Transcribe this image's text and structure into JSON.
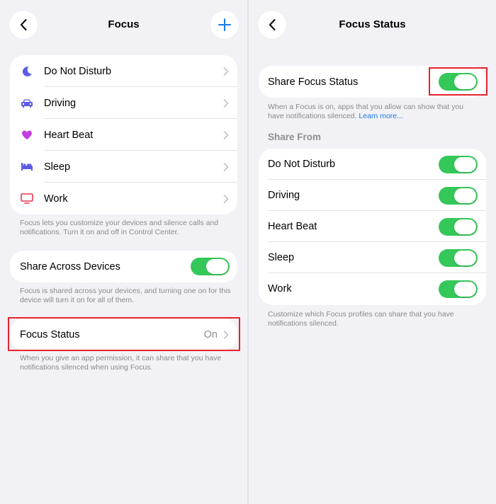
{
  "left": {
    "title": "Focus",
    "modes": [
      {
        "label": "Do Not Disturb",
        "icon": "moon-icon",
        "color": "#5e5ce6"
      },
      {
        "label": "Driving",
        "icon": "car-icon",
        "color": "#5e5ce6"
      },
      {
        "label": "Heart Beat",
        "icon": "heart-icon",
        "color": "#c33fe0"
      },
      {
        "label": "Sleep",
        "icon": "bed-icon",
        "color": "#5e5ce6"
      },
      {
        "label": "Work",
        "icon": "monitor-icon",
        "color": "#e6364e"
      }
    ],
    "modes_footer": "Focus lets you customize your devices and silence calls and notifications. Turn it on and off in Control Center.",
    "share_across": {
      "label": "Share Across Devices",
      "on": true
    },
    "share_footer": "Focus is shared across your devices, and turning one on for this device will turn it on for all of them.",
    "focus_status": {
      "label": "Focus Status",
      "value": "On"
    },
    "status_footer": "When you give an app permission, it can share that you have notifications silenced when using Focus."
  },
  "right": {
    "title": "Focus Status",
    "share_status": {
      "label": "Share Focus Status",
      "on": true
    },
    "share_footer": "When a Focus is on, apps that you allow can show that you have notifications silenced.",
    "learn_more": "Learn more...",
    "share_from_header": "Share From",
    "share_from": [
      {
        "label": "Do Not Disturb",
        "on": true
      },
      {
        "label": "Driving",
        "on": true
      },
      {
        "label": "Heart Beat",
        "on": true
      },
      {
        "label": "Sleep",
        "on": true
      },
      {
        "label": "Work",
        "on": true
      }
    ],
    "share_from_footer": "Customize which Focus profiles can share that you have notifications silenced."
  },
  "colors": {
    "background": "#f2f1f6",
    "toggle_on": "#34c759",
    "highlight": "#e5232f",
    "accent": "#1a7ae6"
  }
}
